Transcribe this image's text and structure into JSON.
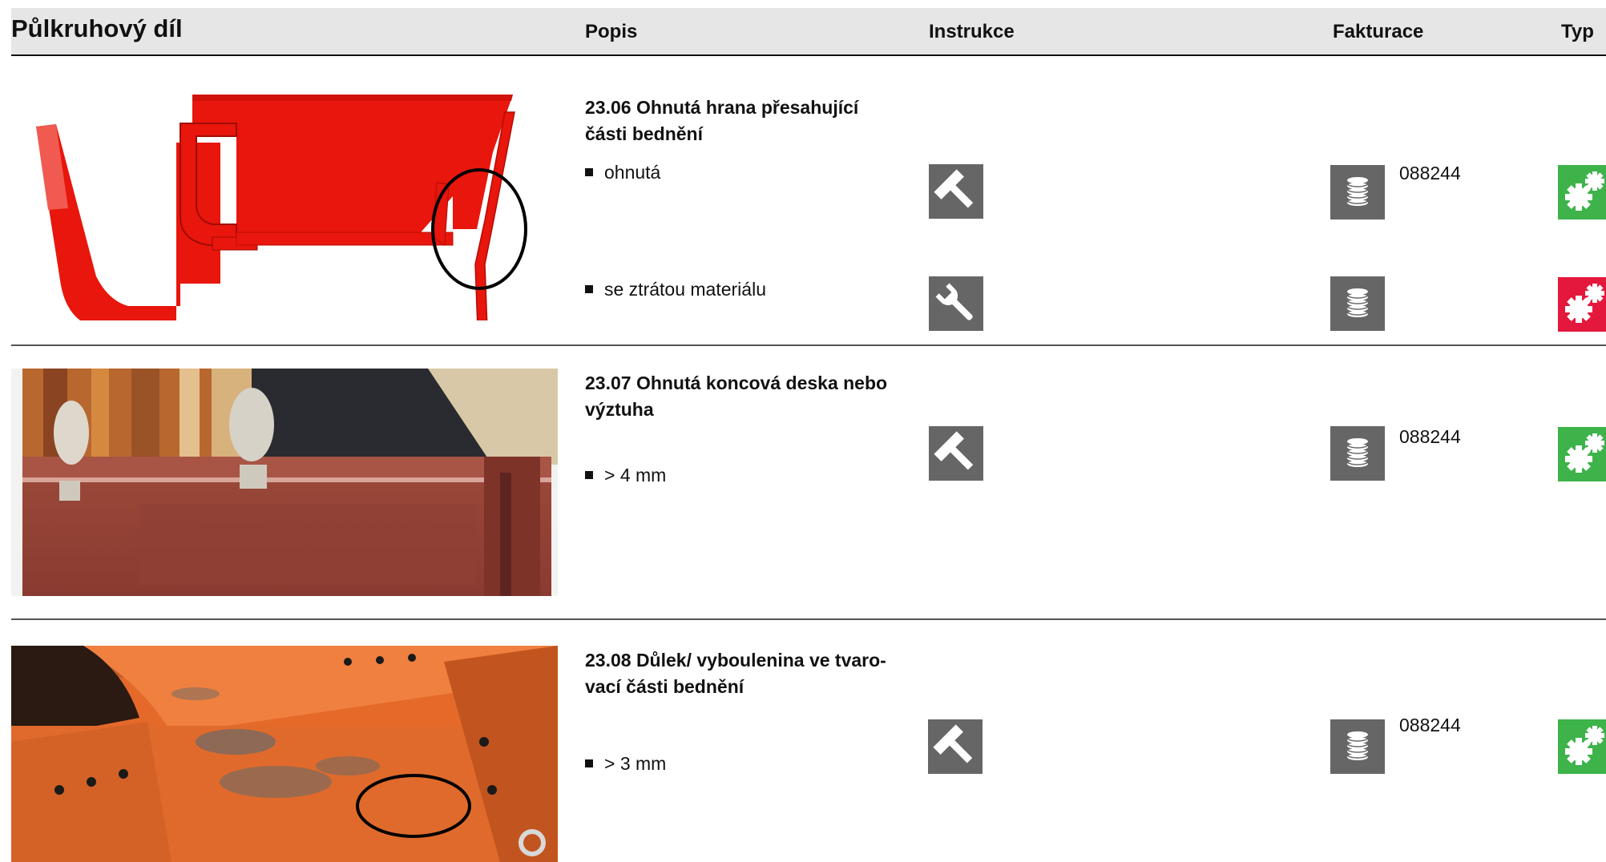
{
  "header": {
    "title": "Půlkruhový díl",
    "col_popis": "Popis",
    "col_instrukce": "Instrukce",
    "col_fakturace": "Fakturace",
    "col_typ": "Typ"
  },
  "colors": {
    "type_green": "#3db34a",
    "type_red": "#e4173c",
    "tile_gray": "#666666",
    "header_bg": "#e6e6e6"
  },
  "items": [
    {
      "title": "23.06 Ohnutá hrana přesahující části bednění",
      "rows": [
        {
          "bullet": "ohnutá",
          "instruction_icon": "hammer-icon",
          "billing_icon": "coin-stack-icon",
          "code": "088244",
          "type_icon": "gears-icon",
          "type_color": "green"
        },
        {
          "bullet": "se ztrátou materiálu",
          "instruction_icon": "wrench-icon",
          "billing_icon": "coin-stack-icon",
          "code": "",
          "type_icon": "gears-icon",
          "type_color": "red"
        }
      ]
    },
    {
      "title": "23.07 Ohnutá koncová deska nebo výztuha",
      "rows": [
        {
          "bullet": "> 4 mm",
          "instruction_icon": "hammer-icon",
          "billing_icon": "coin-stack-icon",
          "code": "088244",
          "type_icon": "gears-icon",
          "type_color": "green"
        }
      ]
    },
    {
      "title": "23.08 Důlek/ vyboulenina  ve tvaro-vací části bednění",
      "rows": [
        {
          "bullet": "> 3 mm",
          "instruction_icon": "hammer-icon",
          "billing_icon": "coin-stack-icon",
          "code": "088244",
          "type_icon": "gears-icon",
          "type_color": "green"
        }
      ]
    }
  ]
}
